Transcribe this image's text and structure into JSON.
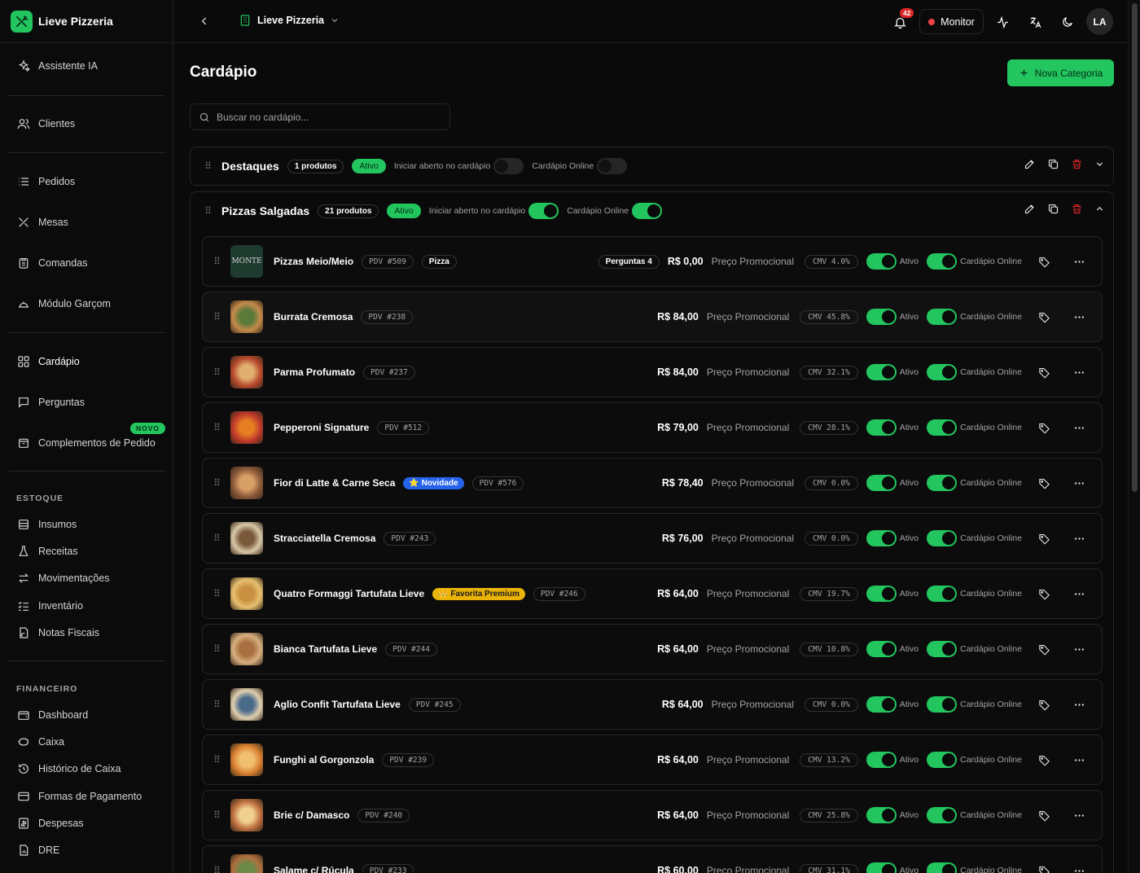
{
  "brand": {
    "name": "Lieve Pizzeria"
  },
  "sidebar": {
    "items": [
      {
        "label": "Assistente IA",
        "icon": "sparkles-icon"
      },
      {
        "label": "Clientes",
        "icon": "users-icon"
      },
      {
        "label": "Pedidos",
        "icon": "list-icon"
      },
      {
        "label": "Mesas",
        "icon": "utensils-icon"
      },
      {
        "label": "Comandas",
        "icon": "clipboard-icon"
      },
      {
        "label": "Módulo Garçom",
        "icon": "cloche-icon"
      },
      {
        "label": "Cardápio",
        "icon": "grid-icon"
      },
      {
        "label": "Perguntas",
        "icon": "message-icon"
      },
      {
        "label": "Complementos de Pedido",
        "icon": "package-icon"
      }
    ],
    "novo_badge": "NOVO",
    "estoque": {
      "title": "ESTOQUE",
      "items": [
        {
          "label": "Insumos",
          "icon": "database-icon"
        },
        {
          "label": "Receitas",
          "icon": "flask-icon"
        },
        {
          "label": "Movimentações",
          "icon": "arrows-icon"
        },
        {
          "label": "Inventário",
          "icon": "checklist-icon"
        },
        {
          "label": "Notas Fiscais",
          "icon": "file-icon"
        }
      ]
    },
    "financeiro": {
      "title": "FINANCEIRO",
      "items": [
        {
          "label": "Dashboard",
          "icon": "wallet-icon"
        },
        {
          "label": "Caixa",
          "icon": "piggy-icon"
        },
        {
          "label": "Histórico de Caixa",
          "icon": "history-icon"
        },
        {
          "label": "Formas de Pagamento",
          "icon": "card-icon"
        },
        {
          "label": "Despesas",
          "icon": "receipt-icon"
        },
        {
          "label": "DRE",
          "icon": "report-icon"
        }
      ]
    }
  },
  "topbar": {
    "store": "Lieve Pizzeria",
    "notifications": "42",
    "monitor": "Monitor",
    "avatar": "LA"
  },
  "main": {
    "title": "Cardápio",
    "new_category": "Nova Categoria",
    "search_placeholder": "Buscar no cardápio..."
  },
  "categories": [
    {
      "name": "Destaques",
      "count": "1 produtos",
      "status": "Ativo",
      "open_label": "Iniciar aberto no cardápio",
      "open": false,
      "online_label": "Cardápio Online",
      "online": false
    },
    {
      "name": "Pizzas Salgadas",
      "count": "21 produtos",
      "status": "Ativo",
      "open_label": "Iniciar aberto no cardápio",
      "open": true,
      "online_label": "Cardápio Online",
      "online": true
    }
  ],
  "row_labels": {
    "promo": "Preço Promocional",
    "active": "Ativo",
    "online": "Cardápio Online"
  },
  "products": [
    {
      "name": "Pizzas Meio/Meio",
      "pdv": "PDV #509",
      "tag": "Pizza",
      "perguntas": "Perguntas 4",
      "price": "R$ 0,00",
      "cmv": "CMV 4.0%",
      "thumb_text": "MONTE"
    },
    {
      "name": "Burrata Cremosa",
      "pdv": "PDV #238",
      "price": "R$ 84,00",
      "cmv": "CMV 45.8%"
    },
    {
      "name": "Parma Profumato",
      "pdv": "PDV #237",
      "price": "R$ 84,00",
      "cmv": "CMV 32.1%"
    },
    {
      "name": "Pepperoni Signature",
      "pdv": "PDV #512",
      "price": "R$ 79,00",
      "cmv": "CMV 28.1%"
    },
    {
      "name": "Fior di Latte & Carne Seca",
      "badge": "⭐ Novidade",
      "badge_type": "nov",
      "pdv": "PDV #576",
      "price": "R$ 78,40",
      "cmv": "CMV 0.0%"
    },
    {
      "name": "Stracciatella Cremosa",
      "pdv": "PDV #243",
      "price": "R$ 76,00",
      "cmv": "CMV 0.0%"
    },
    {
      "name": "Quatro Formaggi Tartufata Lieve",
      "badge": "👑 Favorita Premium",
      "badge_type": "fav",
      "pdv": "PDV #246",
      "price": "R$ 64,00",
      "cmv": "CMV 19.7%"
    },
    {
      "name": "Bianca Tartufata Lieve",
      "pdv": "PDV #244",
      "price": "R$ 64,00",
      "cmv": "CMV 10.8%"
    },
    {
      "name": "Aglio Confit Tartufata Lieve",
      "pdv": "PDV #245",
      "price": "R$ 64,00",
      "cmv": "CMV 0.0%"
    },
    {
      "name": "Funghi al Gorgonzola",
      "pdv": "PDV #239",
      "price": "R$ 64,00",
      "cmv": "CMV 13.2%"
    },
    {
      "name": "Brie c/ Damasco",
      "pdv": "PDV #240",
      "price": "R$ 64,00",
      "cmv": "CMV 25.8%"
    },
    {
      "name": "Salame c/ Rúcula",
      "pdv": "PDV #233",
      "price": "R$ 60,00",
      "cmv": "CMV 31.1%"
    }
  ]
}
